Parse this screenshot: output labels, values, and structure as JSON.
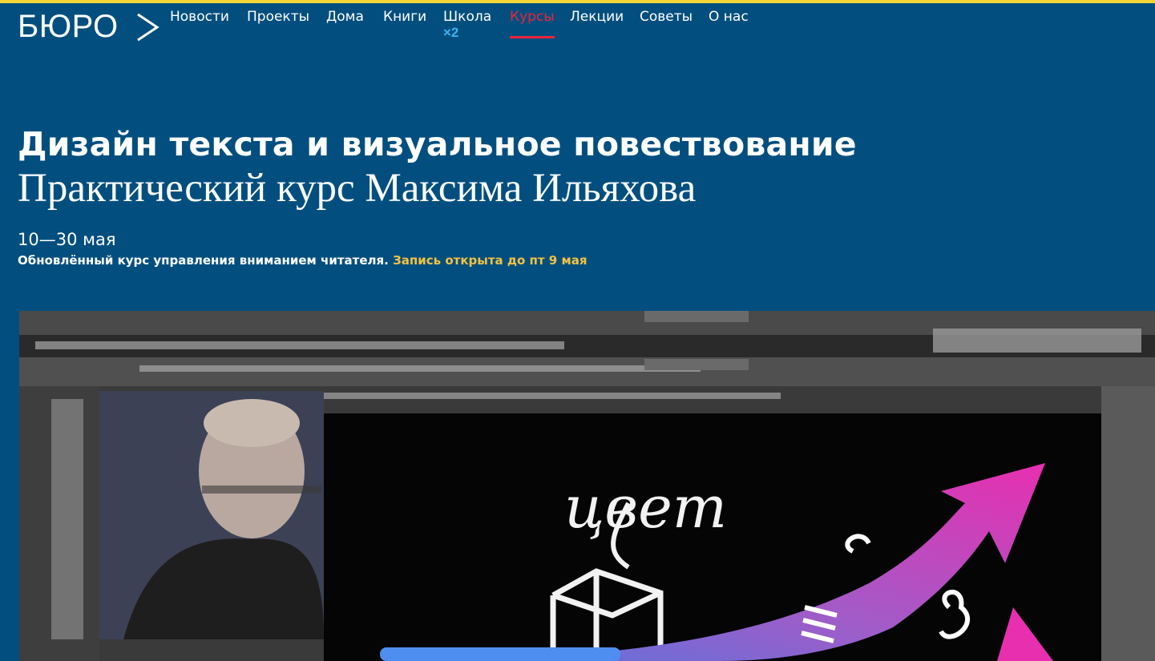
{
  "brand": {
    "logo_text": "БЮРО"
  },
  "nav": {
    "items": [
      {
        "label": "Новости",
        "active": false
      },
      {
        "label": "Проекты",
        "active": false
      },
      {
        "label": "Дома",
        "active": false
      },
      {
        "label": "Книги",
        "active": false
      },
      {
        "label": "Школа",
        "active": false,
        "badge": "×2"
      },
      {
        "label": "Курсы",
        "active": true
      },
      {
        "label": "Лекции",
        "active": false
      },
      {
        "label": "Советы",
        "active": false
      },
      {
        "label": "О нас",
        "active": false
      }
    ]
  },
  "course": {
    "title": "Дизайн текста и визуальное повествование",
    "subtitle": "Практический курс Максима Ильяхова",
    "dates": "10—30 мая",
    "description": "Обновлённый курс управления вниманием читателя.",
    "enrollment": "Запись открыта до пт 9 мая"
  },
  "video": {
    "handwritten_word": "цвет"
  },
  "colors": {
    "background": "#024f7f",
    "top_strip": "#f4d63a",
    "active_nav": "#e8253c",
    "badge": "#3ab4ef",
    "enrollment_highlight": "#f4c242"
  }
}
